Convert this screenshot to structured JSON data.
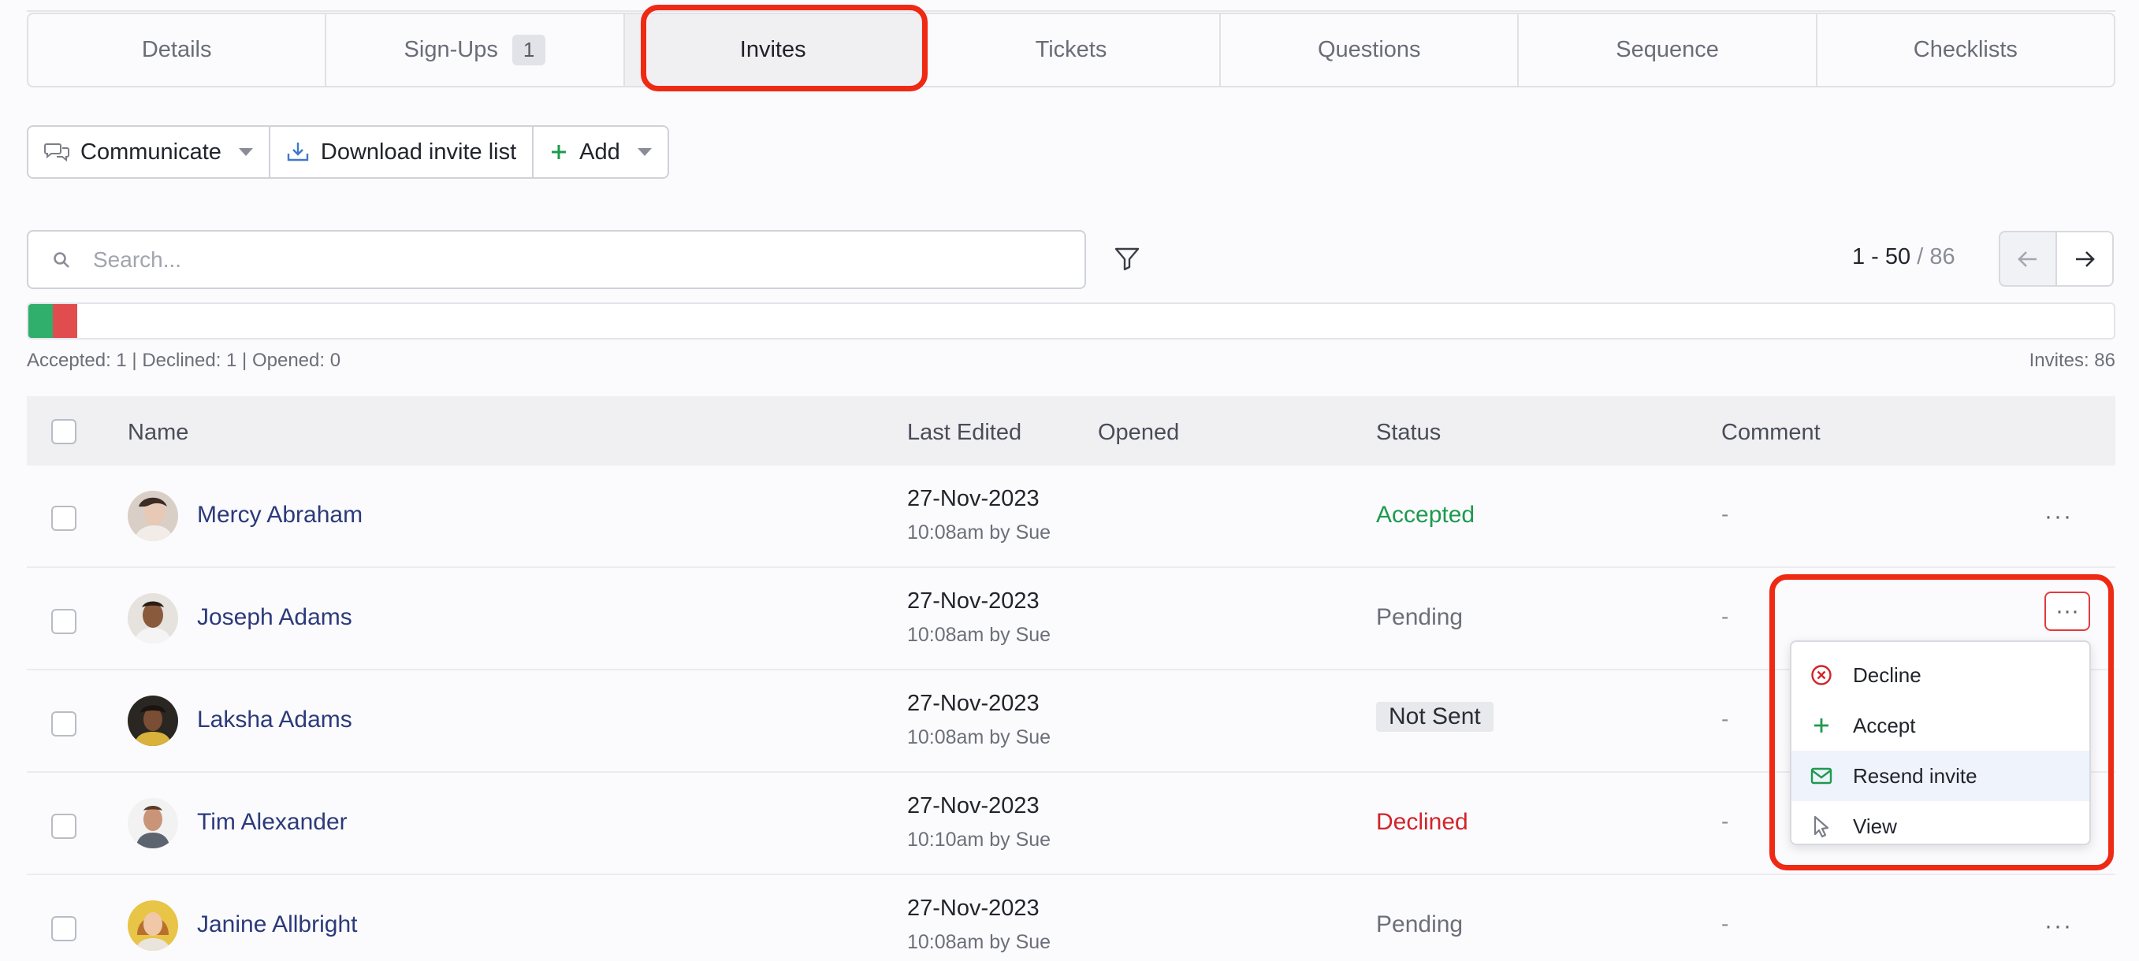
{
  "tabs": [
    {
      "label": "Details"
    },
    {
      "label": "Sign-Ups",
      "badge": "1"
    },
    {
      "label": "Invites"
    },
    {
      "label": "Tickets"
    },
    {
      "label": "Questions"
    },
    {
      "label": "Sequence"
    },
    {
      "label": "Checklists"
    }
  ],
  "toolbar": {
    "communicate": "Communicate",
    "download": "Download invite list",
    "add": "Add"
  },
  "search": {
    "placeholder": "Search..."
  },
  "pager": {
    "range": "1 - 50",
    "total": "/ 86"
  },
  "progress": {
    "accepted": 1,
    "declined": 1,
    "opened": 0,
    "total": 86
  },
  "stats": {
    "summary": "Accepted: 1 | Declined: 1 | Opened: 0",
    "invites": "Invites: 86"
  },
  "table": {
    "headers": {
      "name": "Name",
      "last_edited": "Last Edited",
      "opened": "Opened",
      "status": "Status",
      "comment": "Comment"
    },
    "rows": [
      {
        "name": "Mercy Abraham",
        "date": "27-Nov-2023",
        "by": "10:08am by Sue",
        "status": "Accepted",
        "comment": "-"
      },
      {
        "name": "Joseph Adams",
        "date": "27-Nov-2023",
        "by": "10:08am by Sue",
        "status": "Pending",
        "comment": "-"
      },
      {
        "name": "Laksha Adams",
        "date": "27-Nov-2023",
        "by": "10:08am by Sue",
        "status": "Not Sent",
        "comment": "-"
      },
      {
        "name": "Tim Alexander",
        "date": "27-Nov-2023",
        "by": "10:10am by Sue",
        "status": "Declined",
        "comment": "-"
      },
      {
        "name": "Janine Allbright",
        "date": "27-Nov-2023",
        "by": "10:08am by Sue",
        "status": "Pending",
        "comment": "-"
      }
    ]
  },
  "more_label": "···",
  "menu": {
    "decline": "Decline",
    "accept": "Accept",
    "resend": "Resend invite",
    "view": "View"
  },
  "colors": {
    "accent_highlight": "#ee2a14",
    "accepted": "#1c9a4e",
    "declined": "#d1242b",
    "link": "#2c3a7a"
  }
}
